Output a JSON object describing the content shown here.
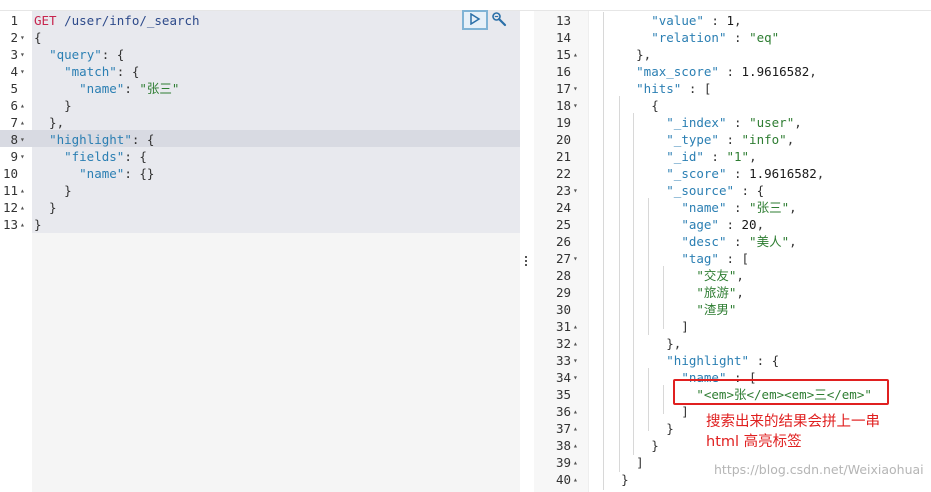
{
  "request": {
    "method": "GET",
    "url": " /user/info/_search",
    "line_numbers": [
      "1",
      "2",
      "3",
      "4",
      "5",
      "6",
      "7",
      "8",
      "9",
      "10",
      "11",
      "12",
      "13"
    ],
    "lines": [
      [
        {
          "t": "m",
          "v": "GET"
        },
        {
          "t": "u",
          "v": " /user/info/_search"
        }
      ],
      [
        {
          "t": "p",
          "v": "{"
        }
      ],
      [
        {
          "t": "p",
          "v": "  "
        },
        {
          "t": "k",
          "v": "\"query\""
        },
        {
          "t": "p",
          "v": ": {"
        }
      ],
      [
        {
          "t": "p",
          "v": "    "
        },
        {
          "t": "k",
          "v": "\"match\""
        },
        {
          "t": "p",
          "v": ": {"
        }
      ],
      [
        {
          "t": "p",
          "v": "      "
        },
        {
          "t": "k",
          "v": "\"name\""
        },
        {
          "t": "p",
          "v": ": "
        },
        {
          "t": "s",
          "v": "\"张三\""
        }
      ],
      [
        {
          "t": "p",
          "v": "    }"
        }
      ],
      [
        {
          "t": "p",
          "v": "  },"
        }
      ],
      [
        {
          "t": "p",
          "v": "  "
        },
        {
          "t": "k",
          "v": "\"highlight\""
        },
        {
          "t": "p",
          "v": ": {"
        }
      ],
      [
        {
          "t": "p",
          "v": "    "
        },
        {
          "t": "k",
          "v": "\"fields\""
        },
        {
          "t": "p",
          "v": ": {"
        }
      ],
      [
        {
          "t": "p",
          "v": "      "
        },
        {
          "t": "k",
          "v": "\"name\""
        },
        {
          "t": "p",
          "v": ": {}"
        }
      ],
      [
        {
          "t": "p",
          "v": "    }"
        }
      ],
      [
        {
          "t": "p",
          "v": "  }"
        }
      ],
      [
        {
          "t": "p",
          "v": "}"
        }
      ]
    ]
  },
  "response": {
    "line_numbers": [
      "13",
      "14",
      "15",
      "16",
      "17",
      "18",
      "19",
      "20",
      "21",
      "22",
      "23",
      "24",
      "25",
      "26",
      "27",
      "28",
      "29",
      "30",
      "31",
      "32",
      "33",
      "34",
      "35",
      "36",
      "37",
      "38",
      "39",
      "40"
    ],
    "lines": [
      [
        {
          "t": "p",
          "v": "        "
        },
        {
          "t": "k",
          "v": "\"value\""
        },
        {
          "t": "p",
          "v": " : "
        },
        {
          "t": "n",
          "v": "1"
        },
        {
          "t": "p",
          "v": ","
        }
      ],
      [
        {
          "t": "p",
          "v": "        "
        },
        {
          "t": "k",
          "v": "\"relation\""
        },
        {
          "t": "p",
          "v": " : "
        },
        {
          "t": "s",
          "v": "\"eq\""
        }
      ],
      [
        {
          "t": "p",
          "v": "      },"
        }
      ],
      [
        {
          "t": "p",
          "v": "      "
        },
        {
          "t": "k",
          "v": "\"max_score\""
        },
        {
          "t": "p",
          "v": " : "
        },
        {
          "t": "n",
          "v": "1.9616582"
        },
        {
          "t": "p",
          "v": ","
        }
      ],
      [
        {
          "t": "p",
          "v": "      "
        },
        {
          "t": "k",
          "v": "\"hits\""
        },
        {
          "t": "p",
          "v": " : ["
        }
      ],
      [
        {
          "t": "p",
          "v": "        {"
        }
      ],
      [
        {
          "t": "p",
          "v": "          "
        },
        {
          "t": "k",
          "v": "\"_index\""
        },
        {
          "t": "p",
          "v": " : "
        },
        {
          "t": "s",
          "v": "\"user\""
        },
        {
          "t": "p",
          "v": ","
        }
      ],
      [
        {
          "t": "p",
          "v": "          "
        },
        {
          "t": "k",
          "v": "\"_type\""
        },
        {
          "t": "p",
          "v": " : "
        },
        {
          "t": "s",
          "v": "\"info\""
        },
        {
          "t": "p",
          "v": ","
        }
      ],
      [
        {
          "t": "p",
          "v": "          "
        },
        {
          "t": "k",
          "v": "\"_id\""
        },
        {
          "t": "p",
          "v": " : "
        },
        {
          "t": "s",
          "v": "\"1\""
        },
        {
          "t": "p",
          "v": ","
        }
      ],
      [
        {
          "t": "p",
          "v": "          "
        },
        {
          "t": "k",
          "v": "\"_score\""
        },
        {
          "t": "p",
          "v": " : "
        },
        {
          "t": "n",
          "v": "1.9616582"
        },
        {
          "t": "p",
          "v": ","
        }
      ],
      [
        {
          "t": "p",
          "v": "          "
        },
        {
          "t": "k",
          "v": "\"_source\""
        },
        {
          "t": "p",
          "v": " : {"
        }
      ],
      [
        {
          "t": "p",
          "v": "            "
        },
        {
          "t": "k",
          "v": "\"name\""
        },
        {
          "t": "p",
          "v": " : "
        },
        {
          "t": "s",
          "v": "\"张三\""
        },
        {
          "t": "p",
          "v": ","
        }
      ],
      [
        {
          "t": "p",
          "v": "            "
        },
        {
          "t": "k",
          "v": "\"age\""
        },
        {
          "t": "p",
          "v": " : "
        },
        {
          "t": "n",
          "v": "20"
        },
        {
          "t": "p",
          "v": ","
        }
      ],
      [
        {
          "t": "p",
          "v": "            "
        },
        {
          "t": "k",
          "v": "\"desc\""
        },
        {
          "t": "p",
          "v": " : "
        },
        {
          "t": "s",
          "v": "\"美人\""
        },
        {
          "t": "p",
          "v": ","
        }
      ],
      [
        {
          "t": "p",
          "v": "            "
        },
        {
          "t": "k",
          "v": "\"tag\""
        },
        {
          "t": "p",
          "v": " : ["
        }
      ],
      [
        {
          "t": "p",
          "v": "              "
        },
        {
          "t": "s",
          "v": "\"交友\""
        },
        {
          "t": "p",
          "v": ","
        }
      ],
      [
        {
          "t": "p",
          "v": "              "
        },
        {
          "t": "s",
          "v": "\"旅游\""
        },
        {
          "t": "p",
          "v": ","
        }
      ],
      [
        {
          "t": "p",
          "v": "              "
        },
        {
          "t": "s",
          "v": "\"渣男\""
        }
      ],
      [
        {
          "t": "p",
          "v": "            ]"
        }
      ],
      [
        {
          "t": "p",
          "v": "          },"
        }
      ],
      [
        {
          "t": "p",
          "v": "          "
        },
        {
          "t": "k",
          "v": "\"highlight\""
        },
        {
          "t": "p",
          "v": " : {"
        }
      ],
      [
        {
          "t": "p",
          "v": "            "
        },
        {
          "t": "k",
          "v": "\"name\""
        },
        {
          "t": "p",
          "v": " : ["
        }
      ],
      [
        {
          "t": "p",
          "v": "              "
        },
        {
          "t": "s",
          "v": "\"<em>张</em><em>三</em>\""
        }
      ],
      [
        {
          "t": "p",
          "v": "            ]"
        }
      ],
      [
        {
          "t": "p",
          "v": "          }"
        }
      ],
      [
        {
          "t": "p",
          "v": "        }"
        }
      ],
      [
        {
          "t": "p",
          "v": "      ]"
        }
      ],
      [
        {
          "t": "p",
          "v": "    }"
        }
      ]
    ]
  },
  "annotation": {
    "line1": "搜索出来的结果会拼上一串",
    "line2": "html 高亮标签"
  },
  "watermark": "https://blog.csdn.net/Weixiaohuai",
  "icons": {
    "run": "play-icon",
    "settings": "wrench-icon",
    "splitter": "drag-handle-icon"
  },
  "colors": {
    "key": "#2b7fb3",
    "string": "#2e7d32",
    "method": "#c7254e",
    "annotation": "#e02020"
  }
}
